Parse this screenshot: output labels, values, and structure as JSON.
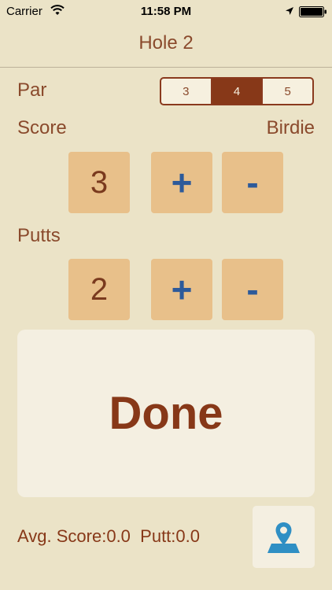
{
  "status_bar": {
    "carrier": "Carrier",
    "time": "11:58 PM"
  },
  "nav": {
    "title": "Hole 2"
  },
  "par": {
    "label": "Par",
    "options": [
      "3",
      "4",
      "5"
    ],
    "selected": "4"
  },
  "score": {
    "label": "Score",
    "result": "Birdie",
    "value": "3",
    "plus": "+",
    "minus": "-"
  },
  "putts": {
    "label": "Putts",
    "value": "2",
    "plus": "+",
    "minus": "-"
  },
  "done": {
    "label": "Done"
  },
  "stats": {
    "avg_score_label": "Avg. Score:",
    "avg_score_value": "0.0",
    "putt_label": "Putt:",
    "putt_value": "0.0"
  },
  "icons": {
    "map": "map-pin-icon",
    "wifi": "wifi-icon",
    "location": "location-arrow-icon",
    "battery": "battery-icon"
  },
  "colors": {
    "background": "#ebe3c7",
    "accent": "#873818",
    "tile": "#e8c08a",
    "operator": "#2d5a9a",
    "panel": "#f4efe1"
  }
}
